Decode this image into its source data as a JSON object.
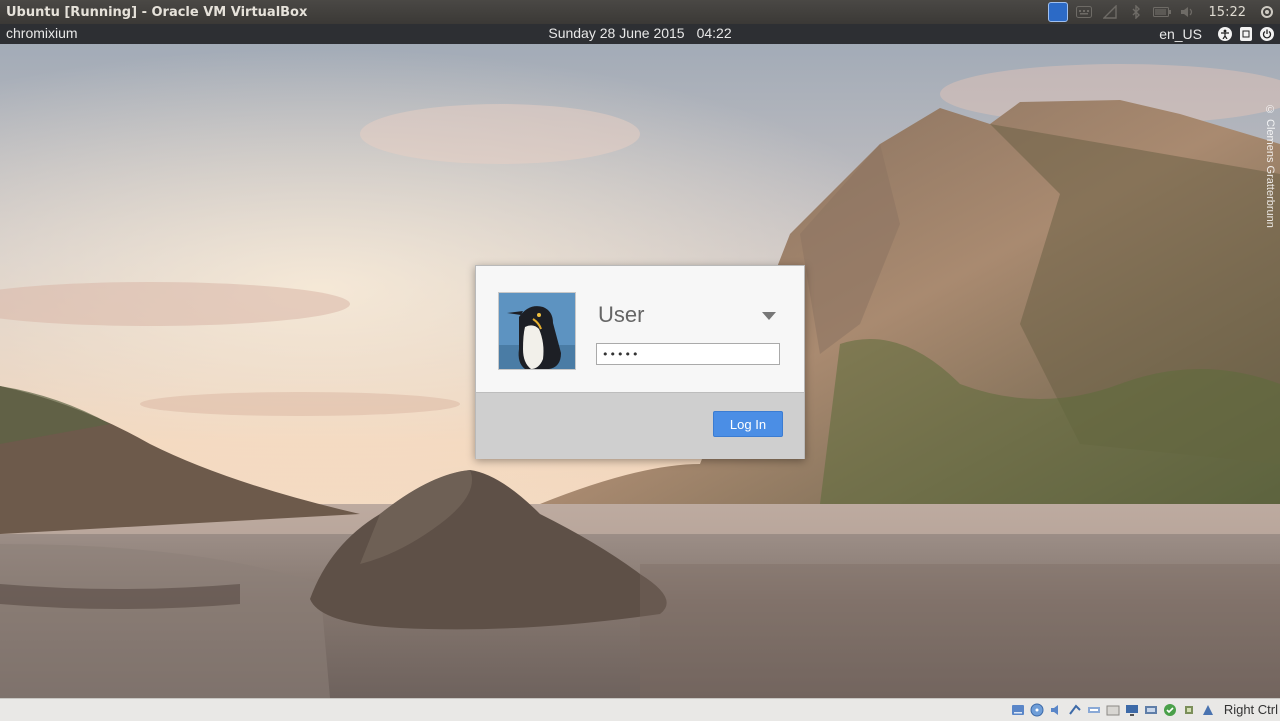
{
  "host_window": {
    "title": "Ubuntu [Running] - Oracle VM VirtualBox",
    "clock": "15:22",
    "tray_icons": [
      "virtualbox-icon",
      "keyboard-icon",
      "network-icon",
      "bluetooth-icon",
      "battery-icon",
      "volume-icon",
      "settings-icon"
    ]
  },
  "guest_bar": {
    "app_name": "chromixium",
    "date": "Sunday 28 June 2015",
    "time": "04:22",
    "locale": "en_US",
    "icons": [
      "accessibility-icon",
      "onscreen-keyboard-icon",
      "power-icon"
    ]
  },
  "wallpaper": {
    "credit": "© Clemens Gratterbrunn"
  },
  "login": {
    "user_name": "User",
    "password_value": "•••••",
    "login_button": "Log In",
    "accent": "#4b8ee5"
  },
  "status_bar": {
    "host_key": "Right Ctrl",
    "icons": [
      "hard-disk-icon",
      "optical-drive-icon",
      "audio-icon",
      "network-icon",
      "usb-icon",
      "shared-folders-icon",
      "display-icon",
      "video-capture-icon",
      "mouse-integration-icon",
      "cpu-icon",
      "host-key-indicator-icon"
    ]
  }
}
